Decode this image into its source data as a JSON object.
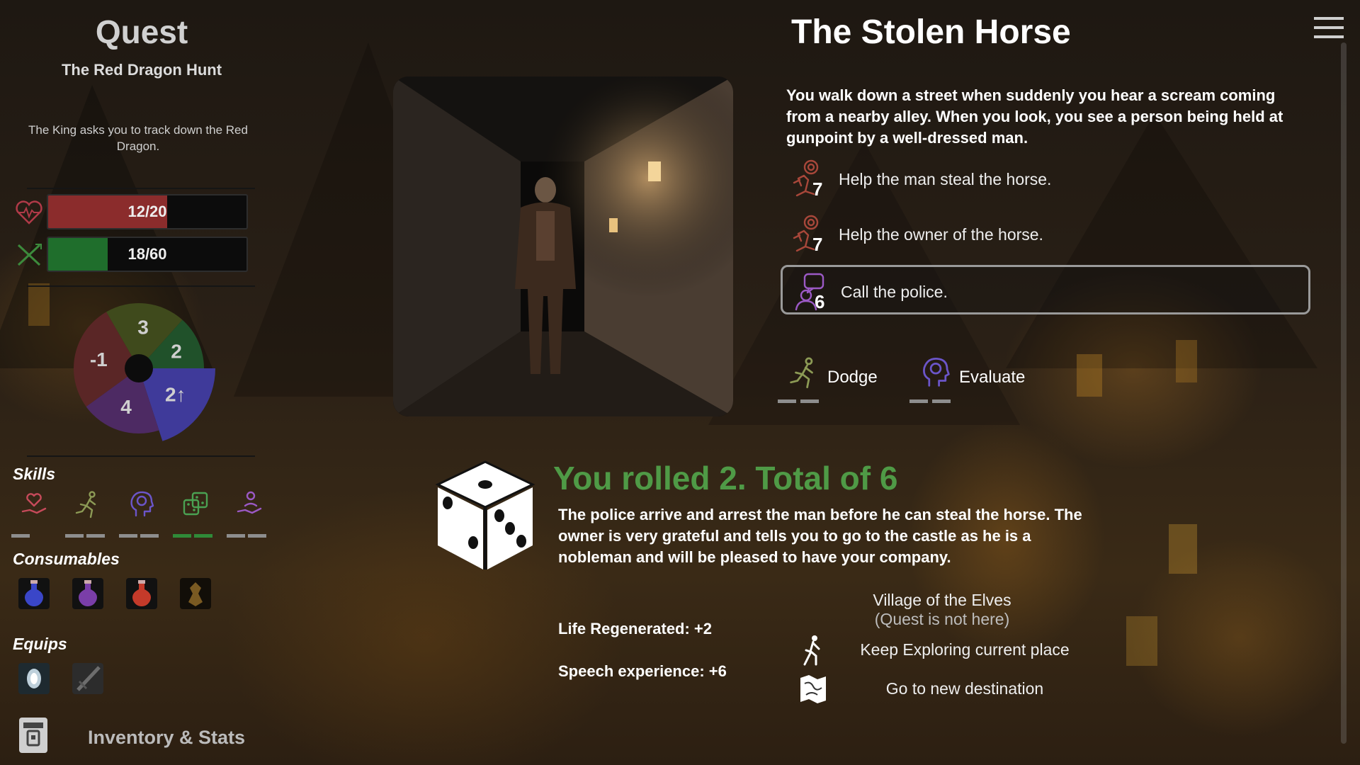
{
  "quest": {
    "heading": "Quest",
    "name": "The Red Dragon Hunt",
    "description": "The King asks you to track down the Red Dragon."
  },
  "stats": {
    "health": {
      "label": "12/20",
      "current": 12,
      "max": 20,
      "color": "#8b2c2c"
    },
    "stamina": {
      "label": "18/60",
      "current": 18,
      "max": 60,
      "color": "#1f6e2c"
    }
  },
  "attribute_wheel": {
    "values": [
      "3",
      "2",
      "2",
      "4",
      "-1"
    ],
    "up_marker": "↑",
    "colors": [
      "#3f4a1c",
      "#20512a",
      "#3f3a9a",
      "#4d2a63",
      "#5a2626"
    ]
  },
  "skills": {
    "heading": "Skills",
    "items": [
      {
        "icon": "heart-hand-icon",
        "color": "#c64a5a"
      },
      {
        "icon": "runner-icon",
        "color": "#8c9a55"
      },
      {
        "icon": "brain-head-icon",
        "color": "#6b55c9"
      },
      {
        "icon": "dice-icon",
        "color": "#4aa152"
      },
      {
        "icon": "hand-person-icon",
        "color": "#9b59c5"
      }
    ]
  },
  "consumables": {
    "heading": "Consumables",
    "items": [
      {
        "icon": "blue-potion-icon",
        "color": "#3a46c8"
      },
      {
        "icon": "purple-potion-icon",
        "color": "#7a3ea8"
      },
      {
        "icon": "red-potion-icon",
        "color": "#c43a2a"
      },
      {
        "icon": "amber-artifact-icon",
        "color": "#7a5a22"
      }
    ]
  },
  "equips": {
    "heading": "Equips",
    "items": [
      {
        "icon": "lantern-icon",
        "color": "#cfe2ee"
      },
      {
        "icon": "dagger-icon",
        "color": "#6d6d6d"
      }
    ]
  },
  "inventory_button": {
    "label": "Inventory & Stats"
  },
  "event": {
    "title": "The Stolen Horse",
    "text": "You walk down a street when suddenly you hear a scream coming from a nearby alley. When you look, you see a person being held at gunpoint by a well-dressed man.",
    "choices": [
      {
        "num": "7",
        "label": "Help the man steal the horse.",
        "icon": "target-runner-icon",
        "color": "#a8473a"
      },
      {
        "num": "7",
        "label": "Help the owner of the horse.",
        "icon": "target-runner-icon",
        "color": "#a8473a"
      },
      {
        "num": "6",
        "label": "Call the police.",
        "icon": "speech-person-icon",
        "color": "#9b59c5",
        "selected": true
      }
    ],
    "checks": [
      {
        "label": "Dodge",
        "icon": "runner-icon",
        "color": "#8c9a55"
      },
      {
        "label": "Evaluate",
        "icon": "brain-head-icon",
        "color": "#6b55c9"
      }
    ]
  },
  "result": {
    "die_face": 2,
    "title": "You rolled 2. Total of 6",
    "title_color": "#4f9a46",
    "text": "The police arrive and arrest the man before he can steal the horse. The owner is very grateful and tells you to go to the castle as he is a nobleman and will be pleased to have your company.",
    "rewards": [
      "Life Regenerated: +2",
      "Speech experience: +6"
    ],
    "destination": {
      "name": "Village of the Elves",
      "note": "(Quest is not here)"
    },
    "nav": [
      {
        "label": "Keep Exploring current place",
        "icon": "walking-person-icon"
      },
      {
        "label": "Go to new destination",
        "icon": "map-icon"
      }
    ]
  },
  "menu": {
    "icon": "hamburger-menu-icon"
  }
}
